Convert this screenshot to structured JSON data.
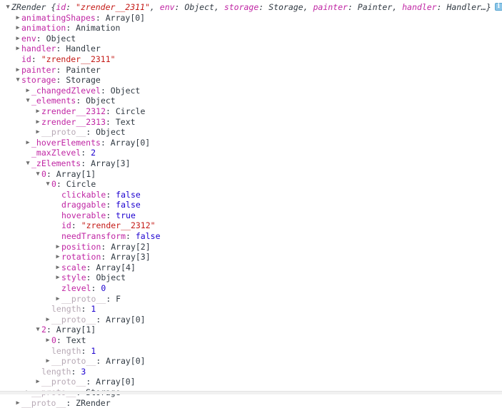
{
  "console": {
    "root_preview": {
      "class_name": "ZRender",
      "open_brace": "{",
      "close_brace": "…}",
      "entries": [
        {
          "key": "id",
          "value": "\"zrender__2311\"",
          "value_type": "string"
        },
        {
          "key": "env",
          "value": "Object",
          "value_type": "object"
        },
        {
          "key": "storage",
          "value": "Storage",
          "value_type": "object"
        },
        {
          "key": "painter",
          "value": "Painter",
          "value_type": "object"
        },
        {
          "key": "handler",
          "value": "Handler",
          "value_type": "object"
        }
      ],
      "info_icon": "info-icon"
    },
    "rows": [
      {
        "indent": 0,
        "marker": "down",
        "key": "ZRender",
        "key_style": "header",
        "value": "",
        "value_type": "header"
      },
      {
        "indent": 1,
        "marker": "right",
        "key": "animatingShapes",
        "key_style": "normal",
        "value": "Array[0]",
        "value_type": "object"
      },
      {
        "indent": 1,
        "marker": "right",
        "key": "animation",
        "key_style": "normal",
        "value": "Animation",
        "value_type": "object"
      },
      {
        "indent": 1,
        "marker": "right",
        "key": "env",
        "key_style": "normal",
        "value": "Object",
        "value_type": "object"
      },
      {
        "indent": 1,
        "marker": "right",
        "key": "handler",
        "key_style": "normal",
        "value": "Handler",
        "value_type": "object"
      },
      {
        "indent": 1,
        "marker": "none",
        "key": "id",
        "key_style": "normal",
        "value": "\"zrender__2311\"",
        "value_type": "string"
      },
      {
        "indent": 1,
        "marker": "right",
        "key": "painter",
        "key_style": "normal",
        "value": "Painter",
        "value_type": "object"
      },
      {
        "indent": 1,
        "marker": "down",
        "key": "storage",
        "key_style": "normal",
        "value": "Storage",
        "value_type": "object"
      },
      {
        "indent": 2,
        "marker": "right",
        "key": "_changedZlevel",
        "key_style": "normal",
        "value": "Object",
        "value_type": "object"
      },
      {
        "indent": 2,
        "marker": "down",
        "key": "_elements",
        "key_style": "normal",
        "value": "Object",
        "value_type": "object"
      },
      {
        "indent": 3,
        "marker": "right",
        "key": "zrender__2312",
        "key_style": "normal",
        "value": "Circle",
        "value_type": "object"
      },
      {
        "indent": 3,
        "marker": "right",
        "key": "zrender__2313",
        "key_style": "normal",
        "value": "Text",
        "value_type": "object"
      },
      {
        "indent": 3,
        "marker": "right",
        "key": "__proto__",
        "key_style": "dim",
        "value": "Object",
        "value_type": "object"
      },
      {
        "indent": 2,
        "marker": "right",
        "key": "_hoverElements",
        "key_style": "normal",
        "value": "Array[0]",
        "value_type": "object"
      },
      {
        "indent": 2,
        "marker": "none",
        "key": "_maxZlevel",
        "key_style": "normal",
        "value": "2",
        "value_type": "number"
      },
      {
        "indent": 2,
        "marker": "down",
        "key": "_zElements",
        "key_style": "normal",
        "value": "Array[3]",
        "value_type": "object"
      },
      {
        "indent": 3,
        "marker": "down",
        "key": "0",
        "key_style": "normal",
        "value": "Array[1]",
        "value_type": "object"
      },
      {
        "indent": 4,
        "marker": "down",
        "key": "0",
        "key_style": "normal",
        "value": "Circle",
        "value_type": "object"
      },
      {
        "indent": 5,
        "marker": "none",
        "key": "clickable",
        "key_style": "normal",
        "value": "false",
        "value_type": "boolean"
      },
      {
        "indent": 5,
        "marker": "none",
        "key": "draggable",
        "key_style": "normal",
        "value": "false",
        "value_type": "boolean"
      },
      {
        "indent": 5,
        "marker": "none",
        "key": "hoverable",
        "key_style": "normal",
        "value": "true",
        "value_type": "boolean"
      },
      {
        "indent": 5,
        "marker": "none",
        "key": "id",
        "key_style": "normal",
        "value": "\"zrender__2312\"",
        "value_type": "string"
      },
      {
        "indent": 5,
        "marker": "none",
        "key": "needTransform",
        "key_style": "normal",
        "value": "false",
        "value_type": "boolean"
      },
      {
        "indent": 5,
        "marker": "right",
        "key": "position",
        "key_style": "normal",
        "value": "Array[2]",
        "value_type": "object"
      },
      {
        "indent": 5,
        "marker": "right",
        "key": "rotation",
        "key_style": "normal",
        "value": "Array[3]",
        "value_type": "object"
      },
      {
        "indent": 5,
        "marker": "right",
        "key": "scale",
        "key_style": "normal",
        "value": "Array[4]",
        "value_type": "object"
      },
      {
        "indent": 5,
        "marker": "right",
        "key": "style",
        "key_style": "normal",
        "value": "Object",
        "value_type": "object"
      },
      {
        "indent": 5,
        "marker": "none",
        "key": "zlevel",
        "key_style": "normal",
        "value": "0",
        "value_type": "number"
      },
      {
        "indent": 5,
        "marker": "right",
        "key": "__proto__",
        "key_style": "dim",
        "value": "F",
        "value_type": "object"
      },
      {
        "indent": 4,
        "marker": "none",
        "key": "length",
        "key_style": "dim",
        "value": "1",
        "value_type": "number"
      },
      {
        "indent": 4,
        "marker": "right",
        "key": "__proto__",
        "key_style": "dim",
        "value": "Array[0]",
        "value_type": "object"
      },
      {
        "indent": 3,
        "marker": "down",
        "key": "2",
        "key_style": "normal",
        "value": "Array[1]",
        "value_type": "object"
      },
      {
        "indent": 4,
        "marker": "right",
        "key": "0",
        "key_style": "normal",
        "value": "Text",
        "value_type": "object"
      },
      {
        "indent": 4,
        "marker": "none",
        "key": "length",
        "key_style": "dim",
        "value": "1",
        "value_type": "number"
      },
      {
        "indent": 4,
        "marker": "right",
        "key": "__proto__",
        "key_style": "dim",
        "value": "Array[0]",
        "value_type": "object"
      },
      {
        "indent": 3,
        "marker": "none",
        "key": "length",
        "key_style": "dim",
        "value": "3",
        "value_type": "number"
      },
      {
        "indent": 3,
        "marker": "right",
        "key": "__proto__",
        "key_style": "dim",
        "value": "Array[0]",
        "value_type": "object"
      },
      {
        "indent": 2,
        "marker": "right",
        "key": "__proto__",
        "key_style": "dim",
        "value": "Storage",
        "value_type": "object"
      },
      {
        "indent": 1,
        "marker": "right",
        "key": "__proto__",
        "key_style": "dim",
        "value": "ZRender",
        "value_type": "object"
      }
    ]
  },
  "colors": {
    "key": "#c026a4",
    "key_dim": "#b7a9b5",
    "string": "#c41a16",
    "number": "#1c00cf",
    "boolean": "#1c00cf",
    "object": "#303942",
    "background": "#ffffff",
    "info_icon": "#8cc6e8"
  },
  "glyphs": {
    "expanded": "▼",
    "collapsed": "▶",
    "separator": ": ",
    "comma": ", "
  }
}
